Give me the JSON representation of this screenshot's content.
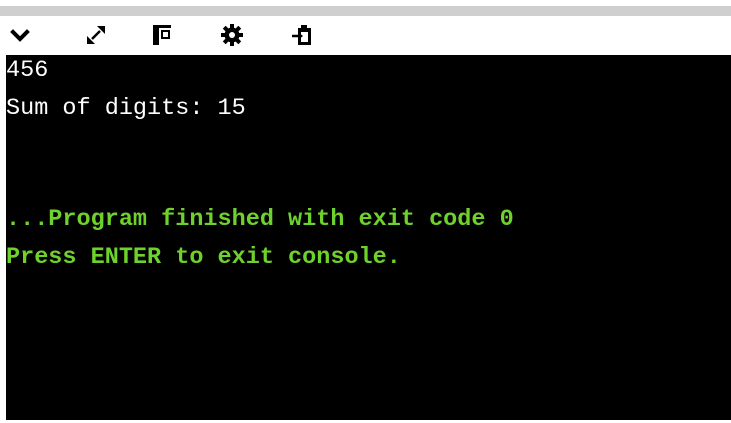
{
  "toolbar": {
    "buttons": [
      {
        "icon": "chevron-down-icon"
      },
      {
        "icon": "expand-icon"
      },
      {
        "icon": "panel-toggle-icon"
      },
      {
        "icon": "gear-icon"
      },
      {
        "icon": "clipboard-icon"
      }
    ]
  },
  "console": {
    "output_lines": [
      "456",
      "Sum of digits: 15"
    ],
    "status_lines": [
      "...Program finished with exit code 0",
      "Press ENTER to exit console."
    ]
  },
  "colors": {
    "console_bg": "#000000",
    "output_text": "#ffffff",
    "status_text": "#6ed22c"
  }
}
